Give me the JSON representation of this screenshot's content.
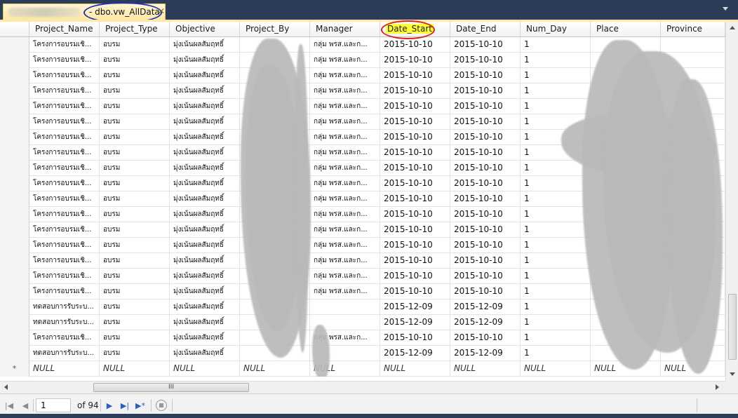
{
  "tab": {
    "title": "- dbo.vw_AllData",
    "close": "✕"
  },
  "columns": [
    {
      "key": "project_name",
      "label": "Project_Name"
    },
    {
      "key": "project_type",
      "label": "Project_Type"
    },
    {
      "key": "objective",
      "label": "Objective"
    },
    {
      "key": "project_by",
      "label": "Project_By"
    },
    {
      "key": "manager",
      "label": "Manager"
    },
    {
      "key": "date_start",
      "label": "Date_Start"
    },
    {
      "key": "date_end",
      "label": "Date_End"
    },
    {
      "key": "num_day",
      "label": "Num_Day"
    },
    {
      "key": "place",
      "label": "Place"
    },
    {
      "key": "province",
      "label": "Province"
    }
  ],
  "rows": [
    {
      "project_name": "โครงการอบรมเชิ...",
      "project_type": "อบรม",
      "objective": "มุ่งเน้นผลสัมฤทธิ์",
      "manager": "กลุ่ม พรส.และก...",
      "date_start": "2015-10-10",
      "date_end": "2015-10-10",
      "num_day": "1"
    },
    {
      "project_name": "โครงการอบรมเชิ...",
      "project_type": "อบรม",
      "objective": "มุ่งเน้นผลสัมฤทธิ์",
      "manager": "กลุ่ม พรส.และก...",
      "date_start": "2015-10-10",
      "date_end": "2015-10-10",
      "num_day": "1"
    },
    {
      "project_name": "โครงการอบรมเชิ...",
      "project_type": "อบรม",
      "objective": "มุ่งเน้นผลสัมฤทธิ์",
      "manager": "กลุ่ม พรส.และก...",
      "date_start": "2015-10-10",
      "date_end": "2015-10-10",
      "num_day": "1"
    },
    {
      "project_name": "โครงการอบรมเชิ...",
      "project_type": "อบรม",
      "objective": "มุ่งเน้นผลสัมฤทธิ์",
      "manager": "กลุ่ม พรส.และก...",
      "date_start": "2015-10-10",
      "date_end": "2015-10-10",
      "num_day": "1"
    },
    {
      "project_name": "โครงการอบรมเชิ...",
      "project_type": "อบรม",
      "objective": "มุ่งเน้นผลสัมฤทธิ์",
      "manager": "กลุ่ม พรส.และก...",
      "date_start": "2015-10-10",
      "date_end": "2015-10-10",
      "num_day": "1"
    },
    {
      "project_name": "โครงการอบรมเชิ...",
      "project_type": "อบรม",
      "objective": "มุ่งเน้นผลสัมฤทธิ์",
      "manager": "กลุ่ม พรส.และก...",
      "date_start": "2015-10-10",
      "date_end": "2015-10-10",
      "num_day": "1"
    },
    {
      "project_name": "โครงการอบรมเชิ...",
      "project_type": "อบรม",
      "objective": "มุ่งเน้นผลสัมฤทธิ์",
      "manager": "กลุ่ม พรส.และก...",
      "date_start": "2015-10-10",
      "date_end": "2015-10-10",
      "num_day": "1"
    },
    {
      "project_name": "โครงการอบรมเชิ...",
      "project_type": "อบรม",
      "objective": "มุ่งเน้นผลสัมฤทธิ์",
      "manager": "กลุ่ม พรส.และก...",
      "date_start": "2015-10-10",
      "date_end": "2015-10-10",
      "num_day": "1"
    },
    {
      "project_name": "โครงการอบรมเชิ...",
      "project_type": "อบรม",
      "objective": "มุ่งเน้นผลสัมฤทธิ์",
      "manager": "กลุ่ม พรส.และก...",
      "date_start": "2015-10-10",
      "date_end": "2015-10-10",
      "num_day": "1"
    },
    {
      "project_name": "โครงการอบรมเชิ...",
      "project_type": "อบรม",
      "objective": "มุ่งเน้นผลสัมฤทธิ์",
      "manager": "กลุ่ม พรส.และก...",
      "date_start": "2015-10-10",
      "date_end": "2015-10-10",
      "num_day": "1"
    },
    {
      "project_name": "โครงการอบรมเชิ...",
      "project_type": "อบรม",
      "objective": "มุ่งเน้นผลสัมฤทธิ์",
      "manager": "กลุ่ม พรส.และก...",
      "date_start": "2015-10-10",
      "date_end": "2015-10-10",
      "num_day": "1"
    },
    {
      "project_name": "โครงการอบรมเชิ...",
      "project_type": "อบรม",
      "objective": "มุ่งเน้นผลสัมฤทธิ์",
      "manager": "กลุ่ม พรส.และก...",
      "date_start": "2015-10-10",
      "date_end": "2015-10-10",
      "num_day": "1"
    },
    {
      "project_name": "โครงการอบรมเชิ...",
      "project_type": "อบรม",
      "objective": "มุ่งเน้นผลสัมฤทธิ์",
      "manager": "กลุ่ม พรส.และก...",
      "date_start": "2015-10-10",
      "date_end": "2015-10-10",
      "num_day": "1"
    },
    {
      "project_name": "โครงการอบรมเชิ...",
      "project_type": "อบรม",
      "objective": "มุ่งเน้นผลสัมฤทธิ์",
      "manager": "กลุ่ม พรส.และก...",
      "date_start": "2015-10-10",
      "date_end": "2015-10-10",
      "num_day": "1"
    },
    {
      "project_name": "โครงการอบรมเชิ...",
      "project_type": "อบรม",
      "objective": "มุ่งเน้นผลสัมฤทธิ์",
      "manager": "กลุ่ม พรส.และก...",
      "date_start": "2015-10-10",
      "date_end": "2015-10-10",
      "num_day": "1"
    },
    {
      "project_name": "โครงการอบรมเชิ...",
      "project_type": "อบรม",
      "objective": "มุ่งเน้นผลสัมฤทธิ์",
      "manager": "กลุ่ม พรส.และก...",
      "date_start": "2015-10-10",
      "date_end": "2015-10-10",
      "num_day": "1"
    },
    {
      "project_name": "โครงการอบรมเชิ...",
      "project_type": "อบรม",
      "objective": "มุ่งเน้นผลสัมฤทธิ์",
      "manager": "กลุ่ม พรส.และก...",
      "date_start": "2015-10-10",
      "date_end": "2015-10-10",
      "num_day": "1"
    },
    {
      "project_name": "ทดสอบการรับระบ...",
      "project_type": "อบรม",
      "objective": "มุ่งเน้นผลสัมฤทธิ์",
      "manager": "",
      "date_start": "2015-12-09",
      "date_end": "2015-12-09",
      "num_day": "1"
    },
    {
      "project_name": "ทดสอบการรับระบ...",
      "project_type": "อบรม",
      "objective": "มุ่งเน้นผลสัมฤทธิ์",
      "manager": "",
      "date_start": "2015-12-09",
      "date_end": "2015-12-09",
      "num_day": "1"
    },
    {
      "project_name": "โครงการอบรมเชิ...",
      "project_type": "อบรม",
      "objective": "มุ่งเน้นผลสัมฤทธิ์",
      "manager": "กลุ่ม พรส.และก...",
      "date_start": "2015-10-10",
      "date_end": "2015-10-10",
      "num_day": "1"
    },
    {
      "project_name": "ทดสอบการรับระบ...",
      "project_type": "อบรม",
      "objective": "มุ่งเน้นผลสัมฤทธิ์",
      "manager": "",
      "date_start": "2015-12-09",
      "date_end": "2015-12-09",
      "num_day": "1"
    }
  ],
  "null_row": {
    "marker": "*",
    "value": "NULL"
  },
  "navigator": {
    "first_icon": "first-record-icon",
    "prev_icon": "previous-record-icon",
    "current_page": "1",
    "of_text": "of 94",
    "next_icon": "next-record-icon",
    "last_icon": "last-record-icon",
    "new_icon": "new-record-icon",
    "stop_icon": "stop-icon"
  },
  "hscroll_grip": "III",
  "colors": {
    "tab_bg": "#ffe8a6",
    "frame_bg": "#2d3e5c",
    "highlight": "#ffff33",
    "circle_blue": "#1c2fbd",
    "circle_red": "#e02020"
  }
}
